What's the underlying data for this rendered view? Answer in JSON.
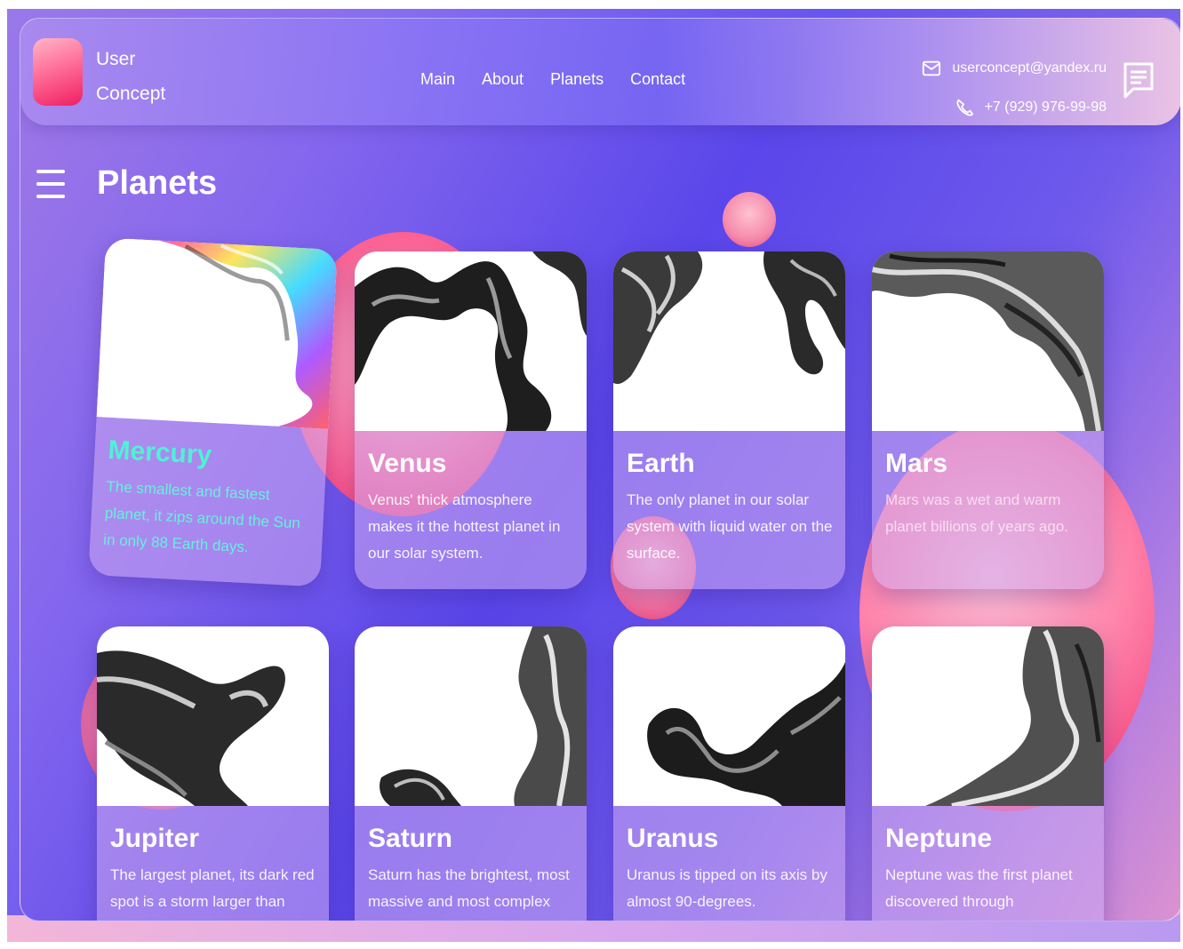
{
  "header": {
    "logo": {
      "line1": "User",
      "line2": "Concept"
    },
    "nav": [
      {
        "label": "Main"
      },
      {
        "label": "About"
      },
      {
        "label": "Planets"
      },
      {
        "label": "Contact"
      }
    ],
    "contact": {
      "email": "userconcept@yandex.ru",
      "phone": "+7 (929) 976-99-98"
    },
    "icons": [
      "mail-icon",
      "phone-icon",
      "chat-icon"
    ]
  },
  "page": {
    "title": "Planets",
    "menu_icon": "hamburger-menu-icon"
  },
  "cards": [
    {
      "name": "Mercury",
      "text": "The smallest and fastest planet, it zips around the Sun in only 88 Earth days."
    },
    {
      "name": "Venus",
      "text": "Venus' thick atmosphere makes it the hottest planet in our solar system."
    },
    {
      "name": "Earth",
      "text": "The only planet in our solar system with liquid water on the surface."
    },
    {
      "name": "Mars",
      "text": "Mars was a wet and warm planet billions of years ago."
    },
    {
      "name": "Jupiter",
      "text": "The largest planet, its dark red spot is a storm larger than"
    },
    {
      "name": "Saturn",
      "text": "Saturn has the brightest, most massive and most complex ring"
    },
    {
      "name": "Uranus",
      "text": "Uranus is tipped on its axis by almost 90-degrees."
    },
    {
      "name": "Neptune",
      "text": "Neptune was the first planet discovered through"
    }
  ],
  "colors": {
    "accent_pink": "#f01e62",
    "mercury_title": "#4ff2d4",
    "background_purple": "#5a46ea"
  }
}
